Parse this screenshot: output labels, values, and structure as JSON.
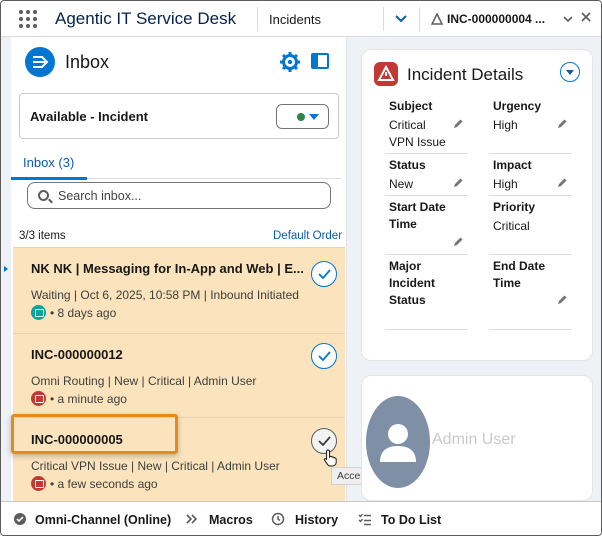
{
  "nav": {
    "app_title": "Agentic IT Service Desk",
    "tab_label": "Incidents",
    "workspace_tab": "INC-000000004 ..."
  },
  "inbox": {
    "title": "Inbox",
    "status": "Available - Incident",
    "tab": "Inbox (3)",
    "search_placeholder": "Search inbox...",
    "items_count": "3/3 items",
    "default_order": "Default Order",
    "items": [
      {
        "title": "NK NK | Messaging for In-App and Web | E...",
        "detail": "Waiting | Oct 6, 2025, 10:58 PM | Inbound Initiated",
        "time": "• 8 days ago",
        "badge_color": "#06a59a"
      },
      {
        "title": "INC-000000012",
        "detail": "Omni Routing | New | Critical | Admin User",
        "time": "• a minute ago",
        "badge_color": "#c23934"
      },
      {
        "title": "INC-000000005",
        "detail": "Critical VPN Issue | New | Critical | Admin User",
        "time": "• a few seconds ago",
        "badge_color": "#c23934"
      }
    ],
    "accept_tooltip": "Accept"
  },
  "details": {
    "title": "Incident Details",
    "fields": {
      "subject_label": "Subject",
      "subject_value_1": "Critical",
      "subject_value_2": "VPN Issue",
      "urgency_label": "Urgency",
      "urgency_value": "High",
      "status_label": "Status",
      "status_value": "New",
      "impact_label": "Impact",
      "impact_value": "High",
      "start_label_1": "Start Date",
      "start_label_2": "Time",
      "priority_label": "Priority",
      "priority_value": "Critical",
      "major_label_1": "Major",
      "major_label_2": "Incident",
      "major_label_3": "Status",
      "end_label_1": "End Date",
      "end_label_2": "Time"
    }
  },
  "user_card": {
    "name": "Admin User"
  },
  "utility_bar": {
    "omni": "Omni-Channel (Online)",
    "macros": "Macros",
    "history": "History",
    "todo": "To Do List"
  },
  "colors": {
    "accent": "#0176d3",
    "work_item_bg": "#fbe4bd",
    "highlight": "#e58a1f",
    "incident_red": "#c23934"
  }
}
